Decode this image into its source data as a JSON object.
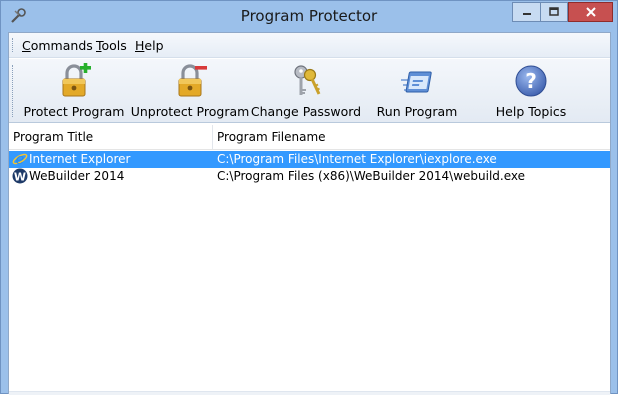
{
  "window": {
    "title": "Program Protector",
    "icon": "wrench-key-icon"
  },
  "menu": {
    "items": [
      {
        "mnemonic": "C",
        "rest": "ommands"
      },
      {
        "mnemonic": "T",
        "rest": "ools"
      },
      {
        "mnemonic": "H",
        "rest": "elp"
      }
    ]
  },
  "toolbar": {
    "buttons": [
      {
        "label": "Protect Program",
        "icon": "padlock-plus-icon"
      },
      {
        "label": "Unprotect Program",
        "icon": "padlock-minus-icon"
      },
      {
        "label": "Change Password",
        "icon": "keys-icon"
      },
      {
        "label": "Run Program",
        "icon": "run-window-icon"
      },
      {
        "label": "Help Topics",
        "icon": "help-question-icon"
      }
    ]
  },
  "list": {
    "columns": [
      "Program Title",
      "Program Filename"
    ],
    "rows": [
      {
        "title": "Internet Explorer",
        "filename": "C:\\Program Files\\Internet Explorer\\iexplore.exe",
        "icon": "internet-explorer-icon",
        "selected": true
      },
      {
        "title": "WeBuilder 2014",
        "filename": "C:\\Program Files (x86)\\WeBuilder 2014\\webuild.exe",
        "icon": "webuilder-icon",
        "selected": false
      }
    ]
  },
  "colors": {
    "titlebar": "#9bc0ea",
    "selection": "#3399ff",
    "close_button": "#c75050"
  }
}
